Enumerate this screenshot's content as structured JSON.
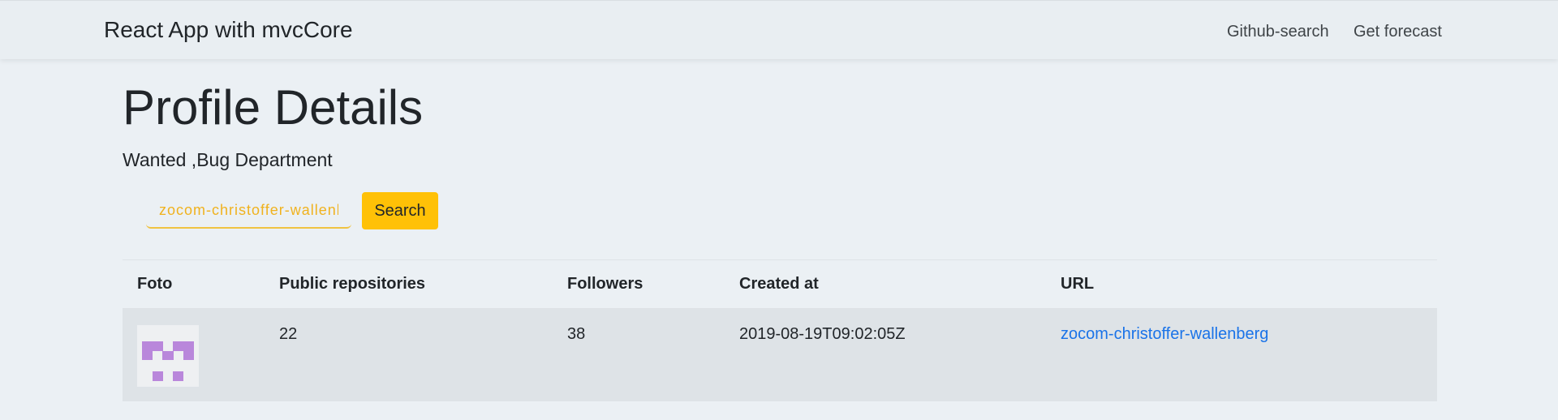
{
  "navbar": {
    "brand": "React App with mvcCore",
    "links": [
      "Github-search",
      "Get forecast"
    ]
  },
  "page": {
    "title": "Profile Details",
    "subtitle": "Wanted ,Bug Department"
  },
  "search": {
    "value": "zocom-christoffer-wallenberg",
    "button_label": "Search"
  },
  "table": {
    "headers": [
      "Foto",
      "Public repositories",
      "Followers",
      "Created at",
      "URL"
    ],
    "rows": [
      {
        "foto": "avatar-identicon",
        "public_repositories": "22",
        "followers": "38",
        "created_at": "2019-08-19T09:02:05Z",
        "url": "zocom-christoffer-wallenberg"
      }
    ]
  },
  "colors": {
    "page_background": "#ebf0f4",
    "accent": "#ffc107",
    "link": "#1a73e8",
    "avatar_pixel": "#b987db"
  }
}
